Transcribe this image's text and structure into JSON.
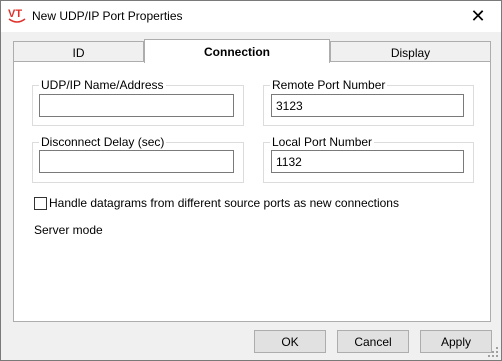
{
  "window": {
    "title": "New UDP/IP Port Properties",
    "logo_text": "VT",
    "close_glyph": "✕"
  },
  "tabs": [
    {
      "label": "ID",
      "active": false
    },
    {
      "label": "Connection",
      "active": true
    },
    {
      "label": "Display",
      "active": false
    }
  ],
  "connection": {
    "udp_name": {
      "label": "UDP/IP Name/Address",
      "value": ""
    },
    "remote_port": {
      "label": "Remote Port Number",
      "value": "3123"
    },
    "disconnect_delay": {
      "label": "Disconnect Delay (sec)",
      "value": ""
    },
    "local_port": {
      "label": "Local Port Number",
      "value": "1132"
    },
    "handle_datagrams": {
      "label": "Handle datagrams from different source ports as new connections",
      "checked": false
    },
    "server_mode_label": "Server mode"
  },
  "buttons": {
    "ok": "OK",
    "cancel": "Cancel",
    "apply": "Apply"
  },
  "colors": {
    "logo_red": "#e0302a",
    "panel_bg": "#ffffff",
    "dialog_bg": "#f0f0f0"
  },
  "icons": [
    "vt-logo-icon",
    "close-icon",
    "resize-grip-icon"
  ]
}
